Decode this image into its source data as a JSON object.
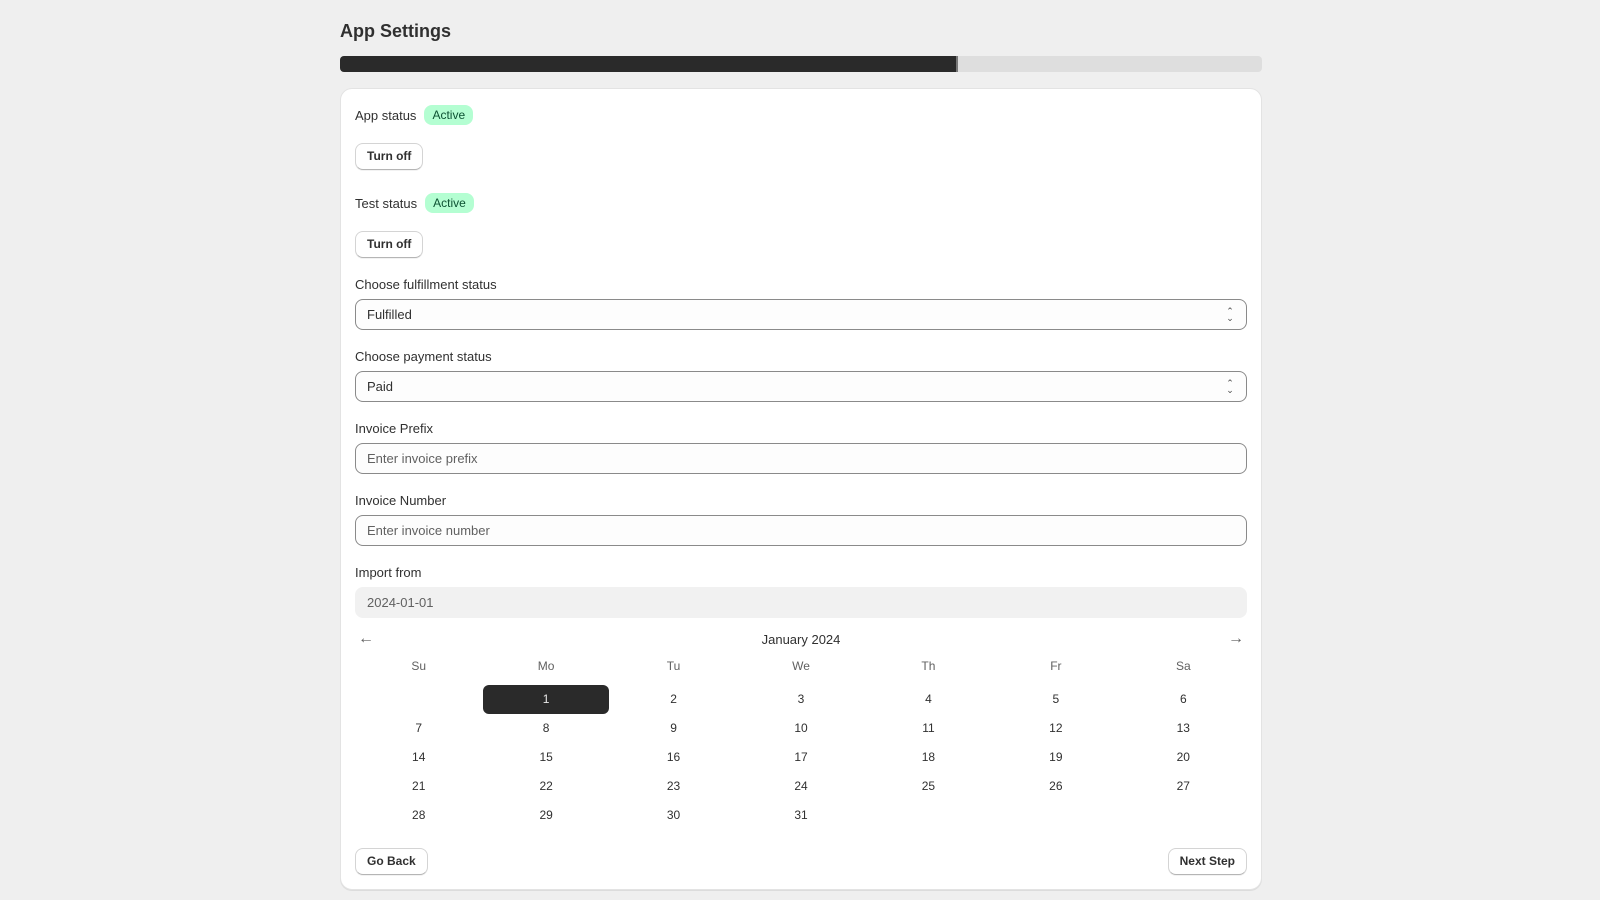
{
  "page": {
    "title": "App Settings",
    "progress_percent": 67
  },
  "app_status": {
    "label": "App status",
    "badge": "Active",
    "button": "Turn off"
  },
  "test_status": {
    "label": "Test status",
    "badge": "Active",
    "button": "Turn off"
  },
  "fulfillment": {
    "label": "Choose fulfillment status",
    "selected": "Fulfilled"
  },
  "payment": {
    "label": "Choose payment status",
    "selected": "Paid"
  },
  "invoice_prefix": {
    "label": "Invoice Prefix",
    "value": "",
    "placeholder": "Enter invoice prefix"
  },
  "invoice_number": {
    "label": "Invoice Number",
    "value": "",
    "placeholder": "Enter invoice number"
  },
  "import_from": {
    "label": "Import from",
    "value": "2024-01-01"
  },
  "calendar": {
    "month_title": "January 2024",
    "prev_icon": "arrow-left-icon",
    "next_icon": "arrow-right-icon",
    "weekdays": [
      "Su",
      "Mo",
      "Tu",
      "We",
      "Th",
      "Fr",
      "Sa"
    ],
    "leading_blanks": 1,
    "days": [
      "1",
      "2",
      "3",
      "4",
      "5",
      "6",
      "7",
      "8",
      "9",
      "10",
      "11",
      "12",
      "13",
      "14",
      "15",
      "16",
      "17",
      "18",
      "19",
      "20",
      "21",
      "22",
      "23",
      "24",
      "25",
      "26",
      "27",
      "28",
      "29",
      "30",
      "31"
    ],
    "selected_day": "1"
  },
  "footer": {
    "back": "Go Back",
    "next": "Next Step"
  },
  "colors": {
    "badge_bg": "#b4fed2",
    "badge_text": "#0c5132",
    "primary_dark": "#2a2a2a",
    "page_bg": "#efefef"
  }
}
